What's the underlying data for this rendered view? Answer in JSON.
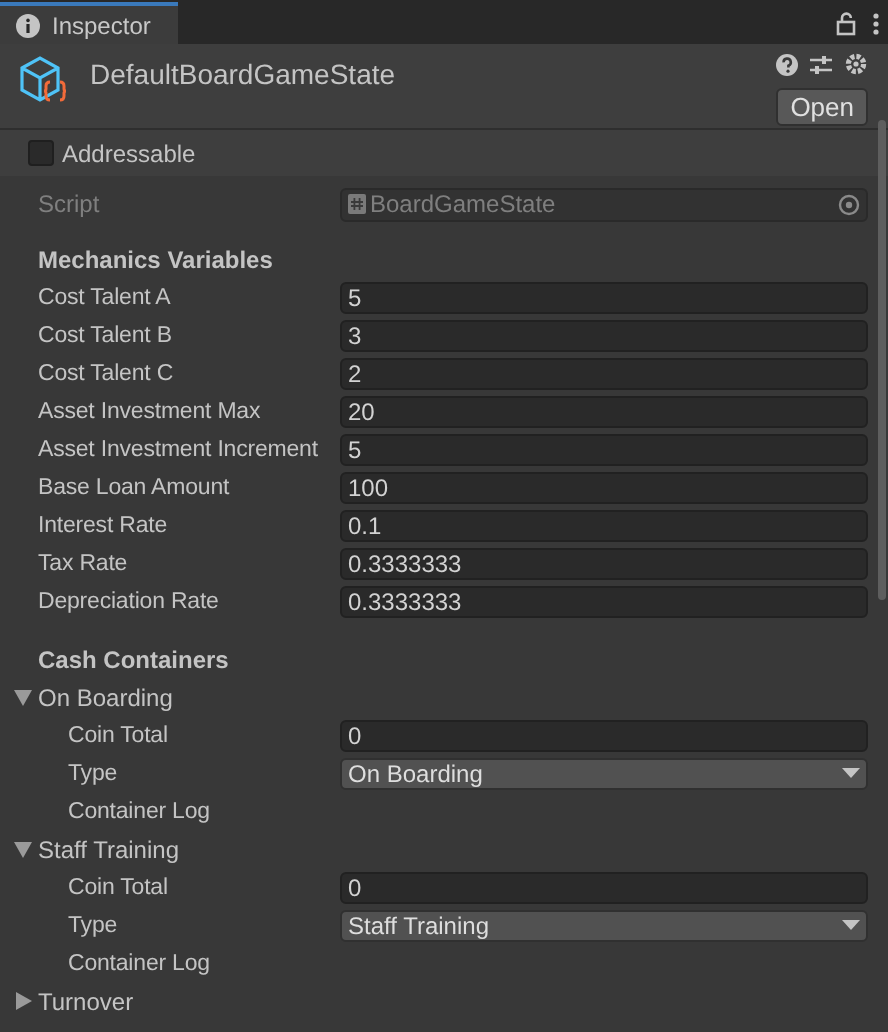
{
  "tab": {
    "label": "Inspector",
    "selected": true
  },
  "header": {
    "title": "DefaultBoardGameState",
    "open_button": "Open"
  },
  "addressable": {
    "label": "Addressable",
    "checked": false
  },
  "script": {
    "label": "Script",
    "value": "BoardGameState",
    "disabled": true
  },
  "sections": [
    {
      "heading": "Mechanics Variables",
      "fields": [
        {
          "label": "Cost Talent A",
          "kind": "number",
          "value": "5"
        },
        {
          "label": "Cost Talent B",
          "kind": "number",
          "value": "3"
        },
        {
          "label": "Cost Talent C",
          "kind": "number",
          "value": "2"
        },
        {
          "label": "Asset Investment Max",
          "kind": "number",
          "value": "20"
        },
        {
          "label": "Asset Investment Increment",
          "kind": "number",
          "value": "5"
        },
        {
          "label": "Base Loan Amount",
          "kind": "number",
          "value": "100"
        },
        {
          "label": "Interest Rate",
          "kind": "number",
          "value": "0.1"
        },
        {
          "label": "Tax Rate",
          "kind": "number",
          "value": "0.3333333"
        },
        {
          "label": "Depreciation Rate",
          "kind": "number",
          "value": "0.3333333"
        }
      ]
    },
    {
      "heading": "Cash Containers",
      "containers": [
        {
          "name": "On Boarding",
          "expanded": true,
          "fields": [
            {
              "label": "Coin Total",
              "kind": "number",
              "value": "0"
            },
            {
              "label": "Type",
              "kind": "dropdown",
              "value": "On Boarding"
            },
            {
              "label": "Container Log",
              "kind": "label"
            }
          ]
        },
        {
          "name": "Staff Training",
          "expanded": true,
          "fields": [
            {
              "label": "Coin Total",
              "kind": "number",
              "value": "0"
            },
            {
              "label": "Type",
              "kind": "dropdown",
              "value": "Staff Training"
            },
            {
              "label": "Container Log",
              "kind": "label"
            }
          ]
        },
        {
          "name": "Turnover",
          "expanded": false
        }
      ]
    }
  ]
}
